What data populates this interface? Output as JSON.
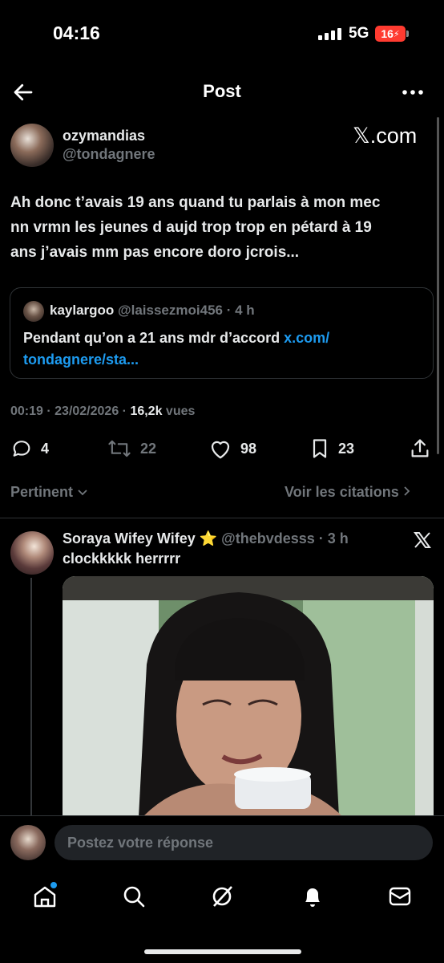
{
  "status_bar": {
    "time": "04:16",
    "network": "5G",
    "battery": "16"
  },
  "header": {
    "title": "Post"
  },
  "post": {
    "display_name": "ozymandias",
    "handle": "@tondagnere",
    "watermark": "𝕏.com",
    "text_lines": [
      "Ah donc t’avais 19 ans quand tu parlais à mon mec",
      "nn vrmn les jeunes d aujd trop trop en pétard à 19",
      "ans j’avais mm pas encore doro jcrois..."
    ],
    "quote": {
      "display_name": "kaylargoo",
      "handle_time": "@laissezmoi456 · 4 h",
      "text": "Pendant qu’on a 21 ans mdr d’accord ",
      "link_part1": "x.com/",
      "link_part2": "tondagnere/sta..."
    },
    "meta": {
      "time_date": "00:19 · 23/02/2026 · ",
      "views_count": "16,2k",
      "views_label": " vues"
    },
    "actions": {
      "replies": "4",
      "reposts": "22",
      "likes": "98",
      "bookmarks": "23"
    }
  },
  "sort": {
    "left": "Pertinent",
    "right": "Voir les citations"
  },
  "reply": {
    "display_name": "Soraya Wifey Wifey ⭐",
    "handle_time": "@thebvdesss · 3 h",
    "text": "clockkkkk herrrrr"
  },
  "composer": {
    "placeholder": "Postez votre réponse"
  },
  "colors": {
    "accent": "#1d9bf0",
    "muted": "#71767b",
    "border": "#2f3336"
  }
}
